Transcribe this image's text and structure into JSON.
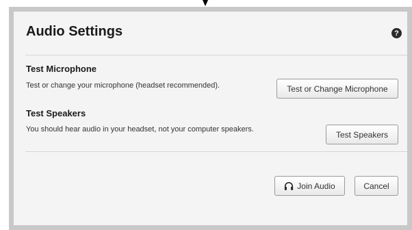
{
  "dialog": {
    "title": "Audio Settings",
    "help_symbol": "?"
  },
  "microphone": {
    "heading": "Test Microphone",
    "description": "Test or change your microphone (headset recommended).",
    "button_label": "Test or Change Microphone"
  },
  "speakers": {
    "heading": "Test Speakers",
    "description": "You should hear audio in your headset, not your computer speakers.",
    "button_label": "Test Speakers"
  },
  "footer": {
    "join_label": "Join Audio",
    "cancel_label": "Cancel"
  },
  "icons": {
    "help": "help-icon",
    "headset": "headset-icon",
    "pointer": "arrow-down-icon"
  },
  "colors": {
    "frame": "#c8c8c8",
    "panel": "#f4f4f4",
    "divider": "#d6d6d6"
  }
}
